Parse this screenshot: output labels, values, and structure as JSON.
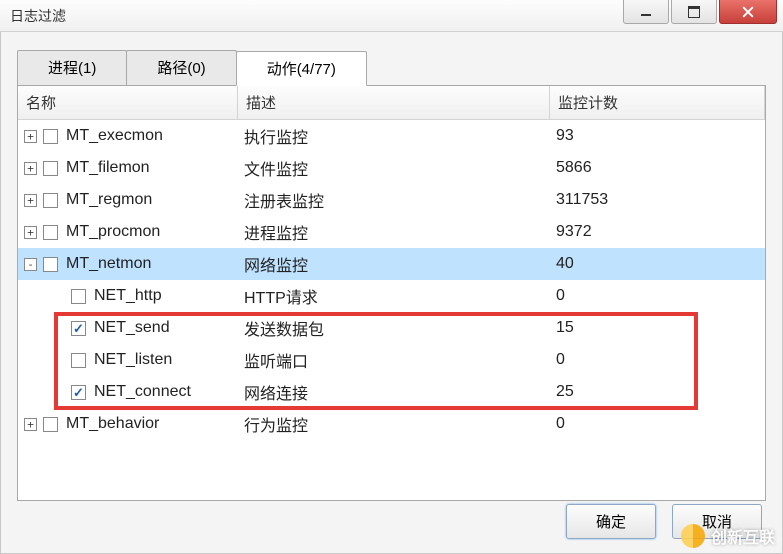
{
  "window": {
    "title": "日志过滤"
  },
  "tabs": [
    {
      "label": "进程(1)",
      "active": false
    },
    {
      "label": "路径(0)",
      "active": false
    },
    {
      "label": "动作(4/77)",
      "active": true
    }
  ],
  "columns": {
    "name": "名称",
    "desc": "描述",
    "count": "监控计数"
  },
  "rows": [
    {
      "exp": "+",
      "indent": 0,
      "checked": false,
      "name": "MT_execmon",
      "desc": "执行监控",
      "count": "93",
      "selected": false
    },
    {
      "exp": "+",
      "indent": 0,
      "checked": false,
      "name": "MT_filemon",
      "desc": "文件监控",
      "count": "5866",
      "selected": false
    },
    {
      "exp": "+",
      "indent": 0,
      "checked": false,
      "name": "MT_regmon",
      "desc": "注册表监控",
      "count": "311753",
      "selected": false
    },
    {
      "exp": "+",
      "indent": 0,
      "checked": false,
      "name": "MT_procmon",
      "desc": "进程监控",
      "count": "9372",
      "selected": false
    },
    {
      "exp": "-",
      "indent": 0,
      "checked": false,
      "name": "MT_netmon",
      "desc": "网络监控",
      "count": "40",
      "selected": true
    },
    {
      "exp": "",
      "indent": 1,
      "checked": false,
      "name": "NET_http",
      "desc": "HTTP请求",
      "count": "0",
      "selected": false
    },
    {
      "exp": "",
      "indent": 1,
      "checked": true,
      "name": "NET_send",
      "desc": "发送数据包",
      "count": "15",
      "selected": false
    },
    {
      "exp": "",
      "indent": 1,
      "checked": false,
      "name": "NET_listen",
      "desc": "监听端口",
      "count": "0",
      "selected": false
    },
    {
      "exp": "",
      "indent": 1,
      "checked": true,
      "name": "NET_connect",
      "desc": "网络连接",
      "count": "25",
      "selected": false
    },
    {
      "exp": "+",
      "indent": 0,
      "checked": false,
      "name": "MT_behavior",
      "desc": "行为监控",
      "count": "0",
      "selected": false
    }
  ],
  "buttons": {
    "ok": "确定",
    "cancel": "取消"
  },
  "watermark": {
    "text": "创新互联"
  }
}
